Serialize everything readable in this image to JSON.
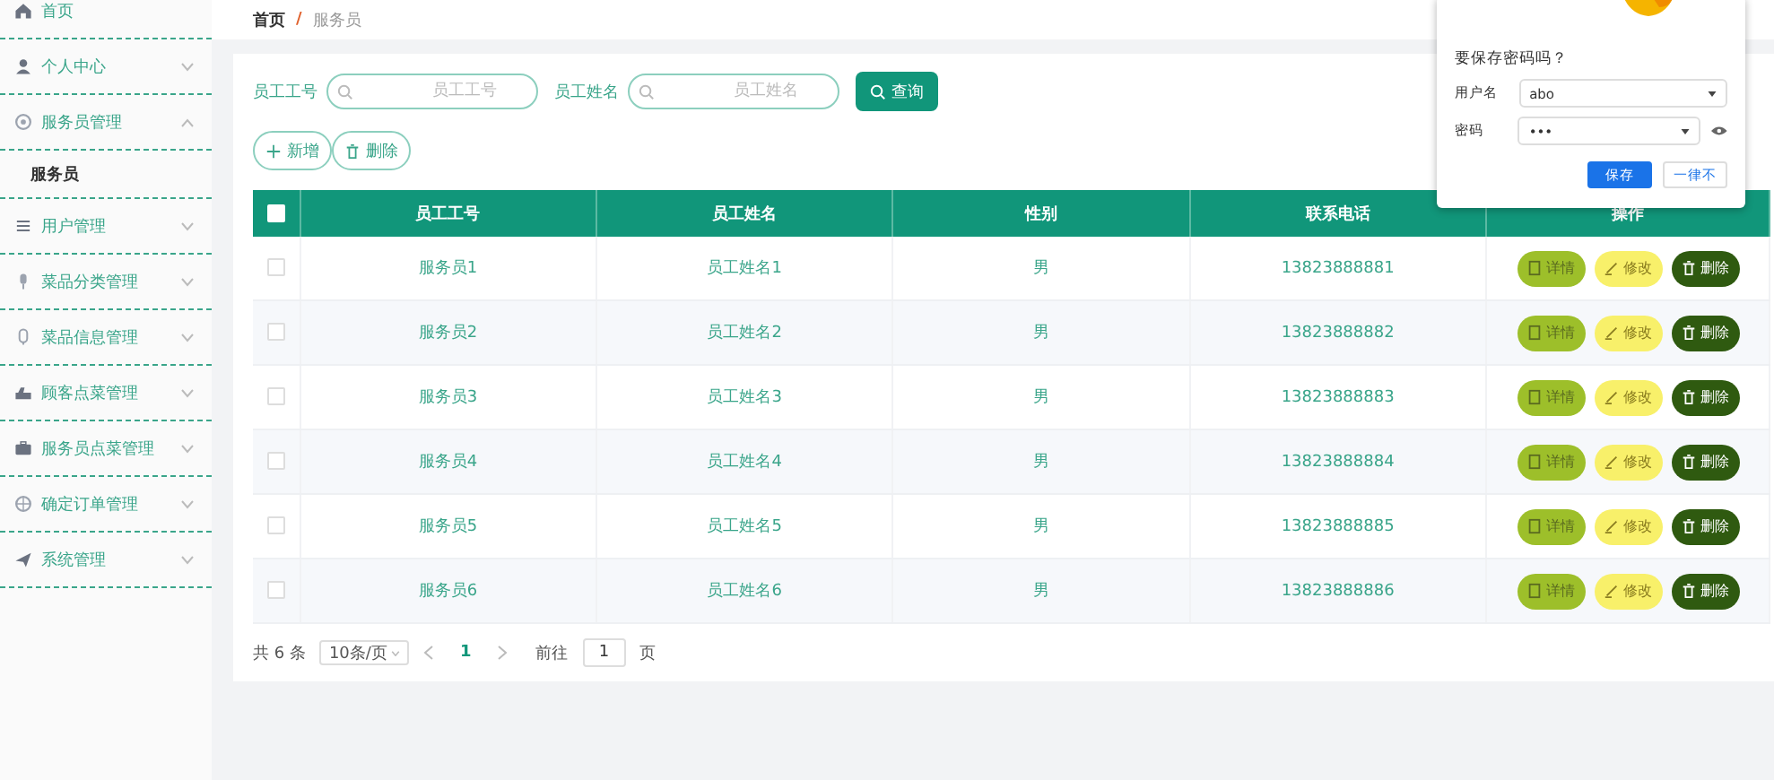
{
  "sidebar": {
    "items": [
      {
        "label": "首页",
        "kind": "link"
      },
      {
        "label": "个人中心",
        "kind": "submenu",
        "expanded": false
      },
      {
        "label": "服务员管理",
        "kind": "submenu",
        "expanded": true,
        "children": [
          {
            "label": "服务员",
            "selected": true
          }
        ]
      },
      {
        "label": "用户管理",
        "kind": "submenu",
        "expanded": false
      },
      {
        "label": "菜品分类管理",
        "kind": "submenu",
        "expanded": false
      },
      {
        "label": "菜品信息管理",
        "kind": "submenu",
        "expanded": false
      },
      {
        "label": "顾客点菜管理",
        "kind": "submenu",
        "expanded": false
      },
      {
        "label": "服务员点菜管理",
        "kind": "submenu",
        "expanded": false
      },
      {
        "label": "确定订单管理",
        "kind": "submenu",
        "expanded": false
      },
      {
        "label": "系统管理",
        "kind": "submenu",
        "expanded": false
      }
    ]
  },
  "breadcrumb": {
    "items": [
      "首页",
      "服务员"
    ],
    "separator": "/"
  },
  "search": {
    "fields": [
      {
        "label": "员工工号",
        "placeholder": "员工工号"
      },
      {
        "label": "员工姓名",
        "placeholder": "员工姓名"
      }
    ],
    "button": "查询"
  },
  "actions": [
    "新增",
    "删除"
  ],
  "table": {
    "select_all": {
      "checked": false
    },
    "columns": [
      "员工工号",
      "员工姓名",
      "性别",
      "联系电话",
      "操作"
    ],
    "rows": [
      {
        "checked": false,
        "cells": [
          "服务员1",
          "员工姓名1",
          "男",
          "13823888881"
        ],
        "actions": [
          {
            "label": "详情",
            "kind": "detail"
          },
          {
            "label": "修改",
            "kind": "edit"
          },
          {
            "label": "删除",
            "kind": "delete"
          }
        ]
      },
      {
        "checked": false,
        "cells": [
          "服务员2",
          "员工姓名2",
          "男",
          "13823888882"
        ],
        "actions": [
          {
            "label": "详情",
            "kind": "detail"
          },
          {
            "label": "修改",
            "kind": "edit"
          },
          {
            "label": "删除",
            "kind": "delete"
          }
        ]
      },
      {
        "checked": false,
        "cells": [
          "服务员3",
          "员工姓名3",
          "男",
          "13823888883"
        ],
        "actions": [
          {
            "label": "详情",
            "kind": "detail"
          },
          {
            "label": "修改",
            "kind": "edit"
          },
          {
            "label": "删除",
            "kind": "delete"
          }
        ]
      },
      {
        "checked": false,
        "cells": [
          "服务员4",
          "员工姓名4",
          "男",
          "13823888884"
        ],
        "actions": [
          {
            "label": "详情",
            "kind": "detail"
          },
          {
            "label": "修改",
            "kind": "edit"
          },
          {
            "label": "删除",
            "kind": "delete"
          }
        ]
      },
      {
        "checked": false,
        "cells": [
          "服务员5",
          "员工姓名5",
          "男",
          "13823888885"
        ],
        "actions": [
          {
            "label": "详情",
            "kind": "detail"
          },
          {
            "label": "修改",
            "kind": "edit"
          },
          {
            "label": "删除",
            "kind": "delete"
          }
        ]
      },
      {
        "checked": false,
        "cells": [
          "服务员6",
          "员工姓名6",
          "男",
          "13823888886"
        ],
        "actions": [
          {
            "label": "详情",
            "kind": "detail"
          },
          {
            "label": "修改",
            "kind": "edit"
          },
          {
            "label": "删除",
            "kind": "delete"
          }
        ]
      }
    ]
  },
  "pagination": {
    "total": "共 6 条",
    "page_size": "10条/页",
    "pages": [
      {
        "label": "1",
        "selected": true
      }
    ],
    "goto_label": "前往",
    "goto_value": "1",
    "goto_unit": "页"
  },
  "password_dialog": {
    "title": "要保存密码吗？",
    "username_label": "用户名",
    "username": "abo",
    "password_label": "密码",
    "password": "•••",
    "buttons": [
      {
        "label": "保存",
        "kind": "primary"
      },
      {
        "label": "一律不",
        "kind": "secondary"
      }
    ]
  }
}
